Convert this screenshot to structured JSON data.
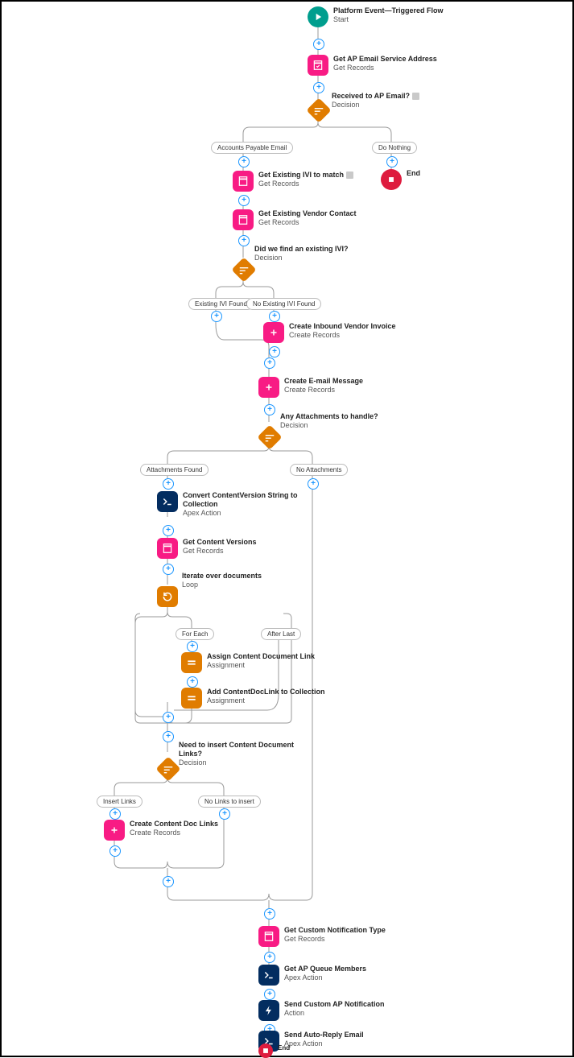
{
  "start": {
    "title": "Platform Event—Triggered Flow",
    "sub": "Start"
  },
  "getAPEmail": {
    "title": "Get AP Email Service Address",
    "sub": "Get Records"
  },
  "decAPEmail": {
    "title": "Received to AP Email?",
    "sub": "Decision"
  },
  "branch": {
    "apEmail": "Accounts Payable Email",
    "doNothing": "Do Nothing",
    "existingIVI": "Existing IVI Found",
    "noIVI": "No Existing IVI Found",
    "attFound": "Attachments Found",
    "noAtt": "No Attachments",
    "forEach": "For Each",
    "afterLast": "After Last",
    "insertLinks": "Insert Links",
    "noLinks": "No Links to insert"
  },
  "endTop": {
    "title": "End"
  },
  "getIVI": {
    "title": "Get Existing IVI to match",
    "sub": "Get Records"
  },
  "getVendor": {
    "title": "Get Existing Vendor Contact",
    "sub": "Get Records"
  },
  "decIVI": {
    "title": "Did we find an existing IVI?",
    "sub": "Decision"
  },
  "createIVI": {
    "title": "Create Inbound Vendor Invoice",
    "sub": "Create Records"
  },
  "createEmail": {
    "title": "Create E-mail Message",
    "sub": "Create Records"
  },
  "decAtt": {
    "title": "Any Attachments to handle?",
    "sub": "Decision"
  },
  "convertCV": {
    "title": "Convert ContentVersion String to Collection",
    "sub": "Apex Action"
  },
  "getCV": {
    "title": "Get Content Versions",
    "sub": "Get Records"
  },
  "loop": {
    "title": "Iterate over documents",
    "sub": "Loop"
  },
  "assign1": {
    "title": "Assign Content Document Link",
    "sub": "Assignment"
  },
  "assign2": {
    "title": "Add ContentDocLink to Collection",
    "sub": "Assignment"
  },
  "decLinks": {
    "title": "Need to insert Content Document Links?",
    "sub": "Decision"
  },
  "createLinks": {
    "title": "Create Content Doc Links",
    "sub": "Create Records"
  },
  "getNotif": {
    "title": "Get Custom Notification Type",
    "sub": "Get Records"
  },
  "getQueue": {
    "title": "Get AP Queue Members",
    "sub": "Apex Action"
  },
  "sendNotif": {
    "title": "Send Custom AP Notification",
    "sub": "Action"
  },
  "sendReply": {
    "title": "Send Auto-Reply Email",
    "sub": "Apex Action"
  },
  "endBottom": {
    "title": "End"
  }
}
